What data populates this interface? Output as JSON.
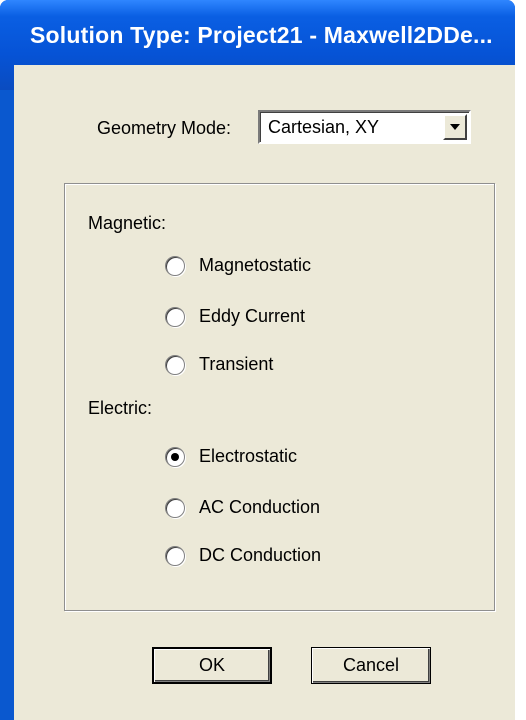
{
  "window": {
    "title": "Solution Type: Project21 - Maxwell2DDe..."
  },
  "geometry": {
    "label": "Geometry Mode:",
    "selected": "Cartesian, XY"
  },
  "magnetic": {
    "label": "Magnetic:",
    "options": [
      {
        "label": "Magnetostatic",
        "checked": false
      },
      {
        "label": "Eddy Current",
        "checked": false
      },
      {
        "label": "Transient",
        "checked": false
      }
    ]
  },
  "electric": {
    "label": "Electric:",
    "options": [
      {
        "label": "Electrostatic",
        "checked": true
      },
      {
        "label": "AC Conduction",
        "checked": false
      },
      {
        "label": "DC Conduction",
        "checked": false
      }
    ]
  },
  "buttons": {
    "ok": "OK",
    "cancel": "Cancel"
  },
  "colors": {
    "titlebar": "#0653d6",
    "dialog_face": "#ece9d8"
  }
}
